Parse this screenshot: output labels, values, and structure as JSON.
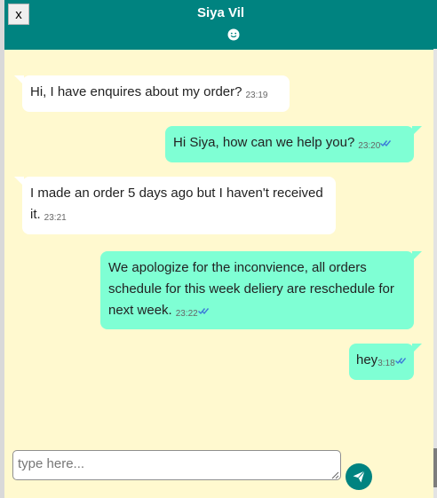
{
  "header": {
    "title": "Siya Vil",
    "close_label": "x",
    "status_icon": "smiley-icon",
    "background": "#008380"
  },
  "messages": [
    {
      "direction": "in",
      "text": "Hi, I have enquires about my order?",
      "time": "23:19",
      "read": false
    },
    {
      "direction": "out",
      "text": "Hi Siya, how can we help you?",
      "time": "23:20",
      "read": true
    },
    {
      "direction": "in",
      "text": "I made an order 5 days ago but I haven't received it.",
      "time": "23:21",
      "read": false
    },
    {
      "direction": "out",
      "text": "We apologize for the inconvience, all orders schedule for this week deliery are reschedule for next week.",
      "time": "23:22",
      "read": true
    },
    {
      "direction": "out",
      "text": "hey",
      "time": "3:18",
      "read": true
    }
  ],
  "composer": {
    "placeholder": "type here...",
    "value": "",
    "send_icon": "paper-plane-icon"
  },
  "colors": {
    "chat_background": "#fff9cf",
    "incoming_bubble": "#ffffff",
    "outgoing_bubble": "#7fffd4",
    "read_tick": "#3b7bd8"
  }
}
